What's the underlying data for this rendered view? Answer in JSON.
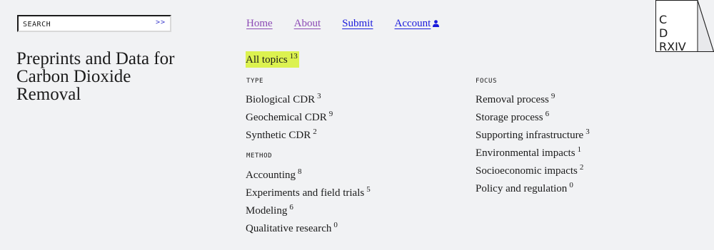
{
  "search": {
    "placeholder": "SEARCH",
    "submit_label": ">>"
  },
  "site": {
    "title": "Preprints and Data for Carbon Dioxide Removal",
    "logo_text": "C\nD\nRXIV"
  },
  "nav": {
    "items": [
      {
        "label": "Home"
      },
      {
        "label": "About"
      },
      {
        "label": "Submit"
      },
      {
        "label": "Account",
        "icon": "user-icon"
      }
    ]
  },
  "topics": {
    "all": {
      "label": "All topics",
      "count": "13"
    },
    "type": {
      "heading": "TYPE",
      "items": [
        {
          "label": "Biological CDR",
          "count": "3"
        },
        {
          "label": "Geochemical CDR",
          "count": "9"
        },
        {
          "label": "Synthetic CDR",
          "count": "2"
        }
      ]
    },
    "method": {
      "heading": "METHOD",
      "items": [
        {
          "label": "Accounting",
          "count": "8"
        },
        {
          "label": "Experiments and field trials",
          "count": "5"
        },
        {
          "label": "Modeling",
          "count": "6"
        },
        {
          "label": "Qualitative research",
          "count": "0"
        }
      ]
    },
    "focus": {
      "heading": "FOCUS",
      "items": [
        {
          "label": "Removal process",
          "count": "9"
        },
        {
          "label": "Storage process",
          "count": "6"
        },
        {
          "label": "Supporting infrastructure",
          "count": "3"
        },
        {
          "label": "Environmental impacts",
          "count": "1"
        },
        {
          "label": "Socioeconomic impacts",
          "count": "2"
        },
        {
          "label": "Policy and regulation",
          "count": "0"
        }
      ]
    }
  },
  "colors": {
    "background": "#f1f2f4",
    "highlight": "#dcf250",
    "link": "#1a1adc",
    "visited_link": "#8c4ab5"
  }
}
